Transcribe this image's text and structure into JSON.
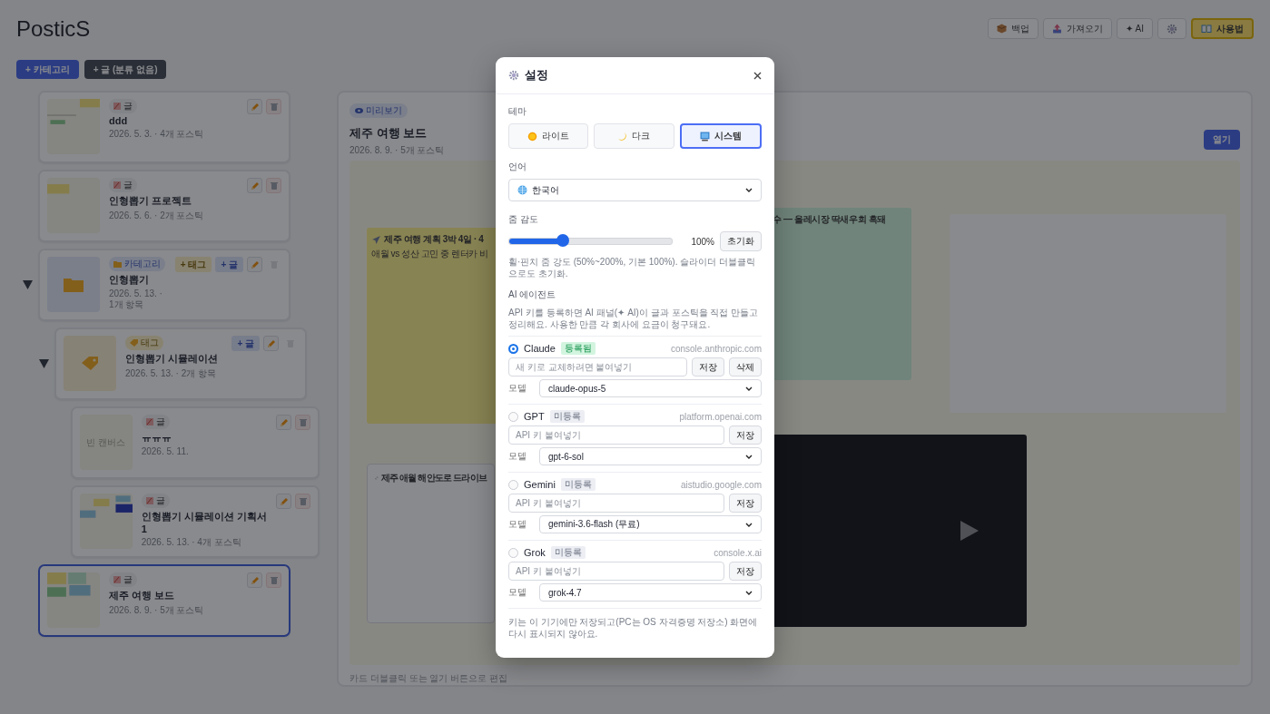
{
  "header": {
    "title": "PosticS",
    "buttons": [
      {
        "label": "백업",
        "highlighted": false
      },
      {
        "label": "가져오기",
        "highlighted": false
      },
      {
        "label": "✦ AI",
        "highlighted": false
      },
      {
        "highlighted": false
      },
      {
        "label": "사용법",
        "highlighted": true
      }
    ]
  },
  "toolbar": [
    {
      "label": "+ 카테고리",
      "kind": "primary"
    },
    {
      "label": "+ 글 (분류 없음)",
      "kind": "dark"
    }
  ],
  "tree": [
    {
      "kind": "post",
      "tag": "글",
      "title": "ddd",
      "meta": "2026. 5. 3. · 4개 포스틱",
      "selected": false
    },
    {
      "kind": "post",
      "tag": "글",
      "title": "인형뽑기 프로젝트",
      "meta": "2026. 5. 6. · 2개 포스틱",
      "selected": false
    },
    {
      "kind": "category",
      "tag": "카테고리",
      "title": "인형뽑기",
      "meta": "2026. 5. 13. · 1개 항목",
      "selected": false,
      "expanded": true,
      "actions": [
        "+ 태그",
        "+ 글"
      ],
      "children": [
        {
          "kind": "tag",
          "tag": "태그",
          "title": "인형뽑기 시뮬레이션",
          "meta": "2026. 5. 13. · 2개 항목",
          "selected": false,
          "expanded": true,
          "actions": [
            "+ 글"
          ],
          "children": [
            {
              "kind": "post",
              "tag": "글",
              "title": "ㅠㅠㅠ",
              "meta": "2026. 5. 11.",
              "thumb_text": "빈 캔버스",
              "selected": false
            },
            {
              "kind": "post",
              "tag": "글",
              "title": "인형뽑기 시뮬레이션 기획서1",
              "meta": "2026. 5. 13. · 4개 포스틱",
              "selected": false
            }
          ]
        }
      ]
    },
    {
      "kind": "post",
      "tag": "글",
      "title": "제주 여행 보드",
      "meta": "2026. 8. 9. · 5개 포스틱",
      "selected": true
    }
  ],
  "preview": {
    "badge": "미리보기",
    "title": "제주 여행 보드",
    "meta": "2026. 8. 9. · 5개 포스틱",
    "open_button": "열기",
    "items": [
      {
        "kind": "note",
        "title": "제주 여행 계획 3박 4일 · 4",
        "body": "애월 vs 성산 고민 중 렌터카 비"
      },
      {
        "kind": "note",
        "title": "수 — 올레시장 딱새우회 흑돼"
      },
      {
        "kind": "note"
      },
      {
        "kind": "link",
        "title": "제주 애월 해안도로 드라이브"
      },
      {
        "kind": "video"
      }
    ],
    "footer": "카드 더블클릭 또는 열기 버튼으로 편집"
  },
  "settings": {
    "title": "설정",
    "theme": {
      "label": "테마",
      "options": [
        {
          "label": "라이트",
          "selected": false
        },
        {
          "label": "다크",
          "selected": false
        },
        {
          "label": "시스템",
          "selected": true
        }
      ]
    },
    "language": {
      "label": "언어",
      "value": "한국어"
    },
    "zoom": {
      "label": "줌 감도",
      "level": 0.33,
      "reading": "100%",
      "reset": "초기화",
      "hint": "휠·핀치 줌 강도 (50%~200%, 기본 100%). 슬라이더 더블클릭으로도 초기화."
    },
    "ai": {
      "label": "AI 에이전트",
      "description": "API 키를 등록하면 AI 패널(✦ AI)이 글과 포스틱을 직접 만들고 정리해요. 사용한 만큼 각 회사에 요금이 청구돼요.",
      "providers": [
        {
          "name": "Claude",
          "status": "등록됨",
          "registered": true,
          "selected": true,
          "site": "console.anthropic.com",
          "placeholder": "새 키로 교체하려면 붙여넣기",
          "buttons": [
            "저장",
            "삭제"
          ],
          "model_label": "모델",
          "model": "claude-opus-5"
        },
        {
          "name": "GPT",
          "status": "미등록",
          "registered": false,
          "selected": false,
          "site": "platform.openai.com",
          "placeholder": "API 키 붙여넣기",
          "buttons": [
            "저장"
          ],
          "model_label": "모델",
          "model": "gpt-6-sol"
        },
        {
          "name": "Gemini",
          "status": "미등록",
          "registered": false,
          "selected": false,
          "site": "aistudio.google.com",
          "placeholder": "API 키 붙여넣기",
          "buttons": [
            "저장"
          ],
          "model_label": "모델",
          "model": "gemini-3.6-flash (무료)"
        },
        {
          "name": "Grok",
          "status": "미등록",
          "registered": false,
          "selected": false,
          "site": "console.x.ai",
          "placeholder": "API 키 붙여넣기",
          "buttons": [
            "저장"
          ],
          "model_label": "모델",
          "model": "grok-4.7"
        }
      ],
      "note": "키는 이 기기에만 저장되고(PC는 OS 자격증명 저장소) 화면에 다시 표시되지 않아요."
    }
  }
}
